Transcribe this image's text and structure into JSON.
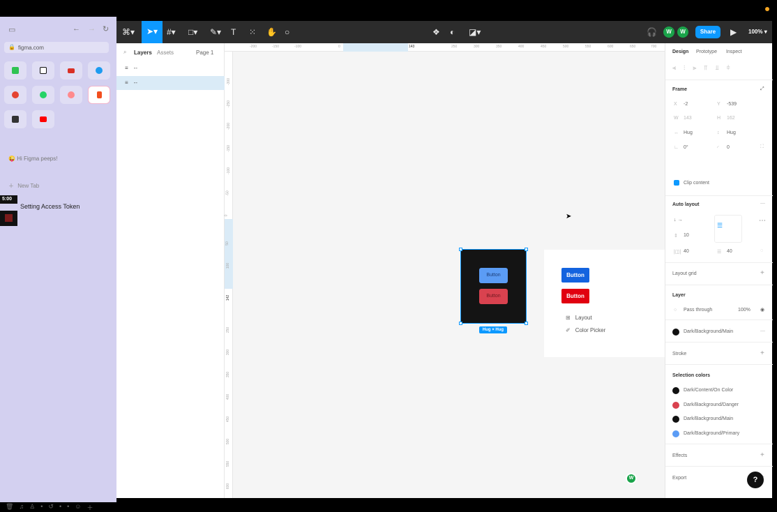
{
  "browser": {
    "url": "figma.com",
    "greeting": "Hi Figma peeps!",
    "new_tab": "New Tab",
    "time_badge": "5:00",
    "token_tab": "Setting Access Token",
    "favorites": [
      {
        "name": "messages",
        "color": "#2fc352"
      },
      {
        "name": "notion",
        "color": "#111111"
      },
      {
        "name": "gmail",
        "color": "#d93025"
      },
      {
        "name": "twitter",
        "color": "#1d9bf0"
      },
      {
        "name": "todoist",
        "color": "#e44332"
      },
      {
        "name": "whatsapp",
        "color": "#25d366"
      },
      {
        "name": "airbnb",
        "color": "#ff5a5f"
      },
      {
        "name": "figma",
        "color": "#f24e1e"
      },
      {
        "name": "craft",
        "color": "#333333"
      },
      {
        "name": "youtube",
        "color": "#ff0000"
      }
    ]
  },
  "figma": {
    "toolbar": {
      "share_label": "Share",
      "zoom": "100%",
      "avatar1": "W",
      "avatar2": "W"
    },
    "left_panel": {
      "tabs": {
        "layers": "Layers",
        "assets": "Assets",
        "page": "Page 1"
      },
      "layers": [
        {
          "label": "--"
        },
        {
          "label": "--"
        }
      ]
    },
    "rulers": {
      "top": [
        "-200",
        "-150",
        "-100",
        "0",
        "143",
        "250",
        "300",
        "350",
        "400",
        "450",
        "500",
        "550",
        "600",
        "650",
        "700"
      ],
      "left": [
        "-300",
        "-250",
        "-200",
        "-150",
        "-100",
        "-50",
        "0",
        "50",
        "100",
        "142",
        "250",
        "300",
        "350",
        "400",
        "450",
        "500",
        "550",
        "600"
      ]
    },
    "canvas": {
      "dark_buttons": [
        "Button",
        "Button"
      ],
      "hug_badge": "Hug × Hug",
      "light_buttons": [
        "Button",
        "Button"
      ],
      "components": [
        "Layout",
        "Color Picker"
      ],
      "collaborator": "W"
    },
    "right_panel": {
      "tabs": {
        "design": "Design",
        "prototype": "Prototype",
        "inspect": "Inspect"
      },
      "frame": {
        "title": "Frame",
        "x": "-2",
        "y": "-539",
        "w": "143",
        "h": "162",
        "width_mode": "Hug",
        "height_mode": "Hug",
        "rotation": "0°",
        "radius": "0",
        "clip": "Clip content"
      },
      "auto_layout": {
        "title": "Auto layout",
        "gap": "10",
        "pad_h": "40",
        "pad_v": "40"
      },
      "layout_grid": "Layout grid",
      "layer": {
        "title": "Layer",
        "blend": "Pass through",
        "opacity": "100%"
      },
      "fill": {
        "name": "Dark/Background/Main",
        "color": "#111111"
      },
      "stroke": "Stroke",
      "selection_colors": {
        "title": "Selection colors",
        "items": [
          {
            "name": "Dark/Content/On Color",
            "color": "#111111"
          },
          {
            "name": "Dark/Background/Danger",
            "color": "#d9424f"
          },
          {
            "name": "Dark/Background/Main",
            "color": "#111111"
          },
          {
            "name": "Dark/Background/Primary",
            "color": "#5b9cf5"
          }
        ]
      },
      "effects": "Effects",
      "export": "Export",
      "help": "?"
    }
  }
}
